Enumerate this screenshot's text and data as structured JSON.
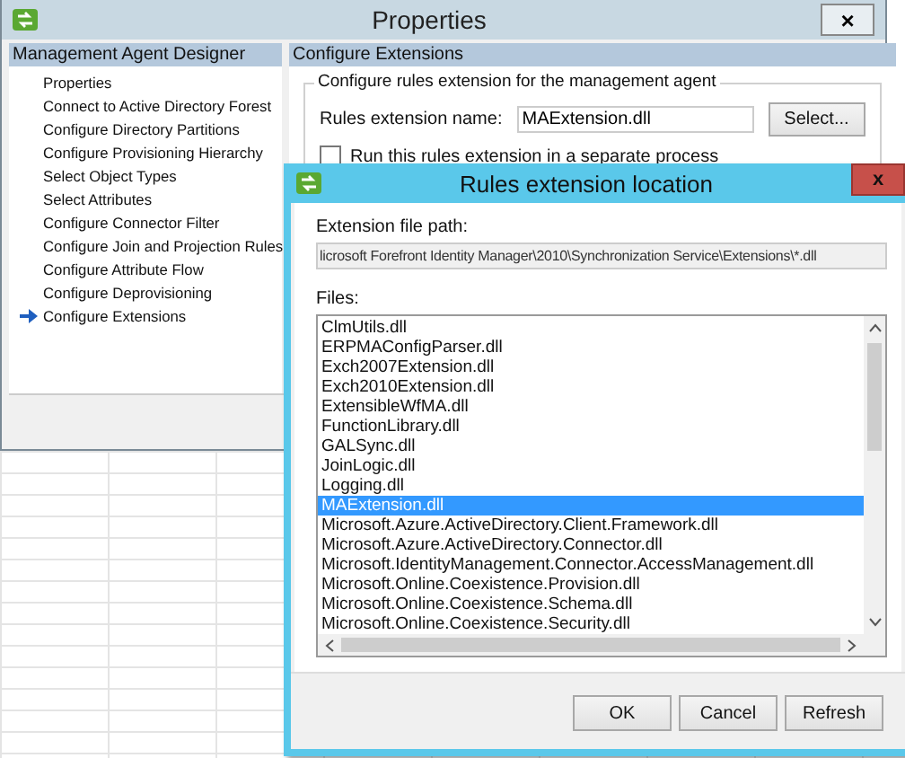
{
  "window": {
    "title": "Properties",
    "close": "×"
  },
  "sidebar": {
    "header": "Management Agent Designer",
    "items": [
      {
        "label": "Properties",
        "selected": false
      },
      {
        "label": "Connect to Active Directory Forest",
        "selected": false
      },
      {
        "label": "Configure Directory Partitions",
        "selected": false
      },
      {
        "label": "Configure Provisioning Hierarchy",
        "selected": false
      },
      {
        "label": "Select Object Types",
        "selected": false
      },
      {
        "label": "Select Attributes",
        "selected": false
      },
      {
        "label": "Configure Connector Filter",
        "selected": false
      },
      {
        "label": "Configure Join and Projection Rules",
        "selected": false
      },
      {
        "label": "Configure Attribute Flow",
        "selected": false
      },
      {
        "label": "Configure Deprovisioning",
        "selected": false
      },
      {
        "label": "Configure Extensions",
        "selected": true
      }
    ]
  },
  "panel": {
    "header": "Configure Extensions",
    "group_title": "Configure rules extension for the management agent",
    "name_label": "Rules extension name:",
    "name_value": "MAExtension.dll",
    "select_button": "Select...",
    "checkbox": {
      "label": "Run this rules extension in a separate process",
      "checked": false
    }
  },
  "dialog": {
    "title": "Rules extension location",
    "close": "x",
    "path_label": "Extension file path:",
    "path_value": "licrosoft Forefront Identity Manager\\2010\\Synchronization Service\\Extensions\\*.dll",
    "files_label": "Files:",
    "files": [
      {
        "name": "ClmUtils.dll",
        "selected": false
      },
      {
        "name": "ERPMAConfigParser.dll",
        "selected": false
      },
      {
        "name": "Exch2007Extension.dll",
        "selected": false
      },
      {
        "name": "Exch2010Extension.dll",
        "selected": false
      },
      {
        "name": "ExtensibleWfMA.dll",
        "selected": false
      },
      {
        "name": "FunctionLibrary.dll",
        "selected": false
      },
      {
        "name": "GALSync.dll",
        "selected": false
      },
      {
        "name": "JoinLogic.dll",
        "selected": false
      },
      {
        "name": "Logging.dll",
        "selected": false
      },
      {
        "name": "MAExtension.dll",
        "selected": true
      },
      {
        "name": "Microsoft.Azure.ActiveDirectory.Client.Framework.dll",
        "selected": false
      },
      {
        "name": "Microsoft.Azure.ActiveDirectory.Connector.dll",
        "selected": false
      },
      {
        "name": "Microsoft.IdentityManagement.Connector.AccessManagement.dll",
        "selected": false
      },
      {
        "name": "Microsoft.Online.Coexistence.Provision.dll",
        "selected": false
      },
      {
        "name": "Microsoft.Online.Coexistence.Schema.dll",
        "selected": false
      },
      {
        "name": "Microsoft.Online.Coexistence.Security.dll",
        "selected": false
      }
    ],
    "buttons": [
      "OK",
      "Cancel",
      "Refresh"
    ]
  }
}
